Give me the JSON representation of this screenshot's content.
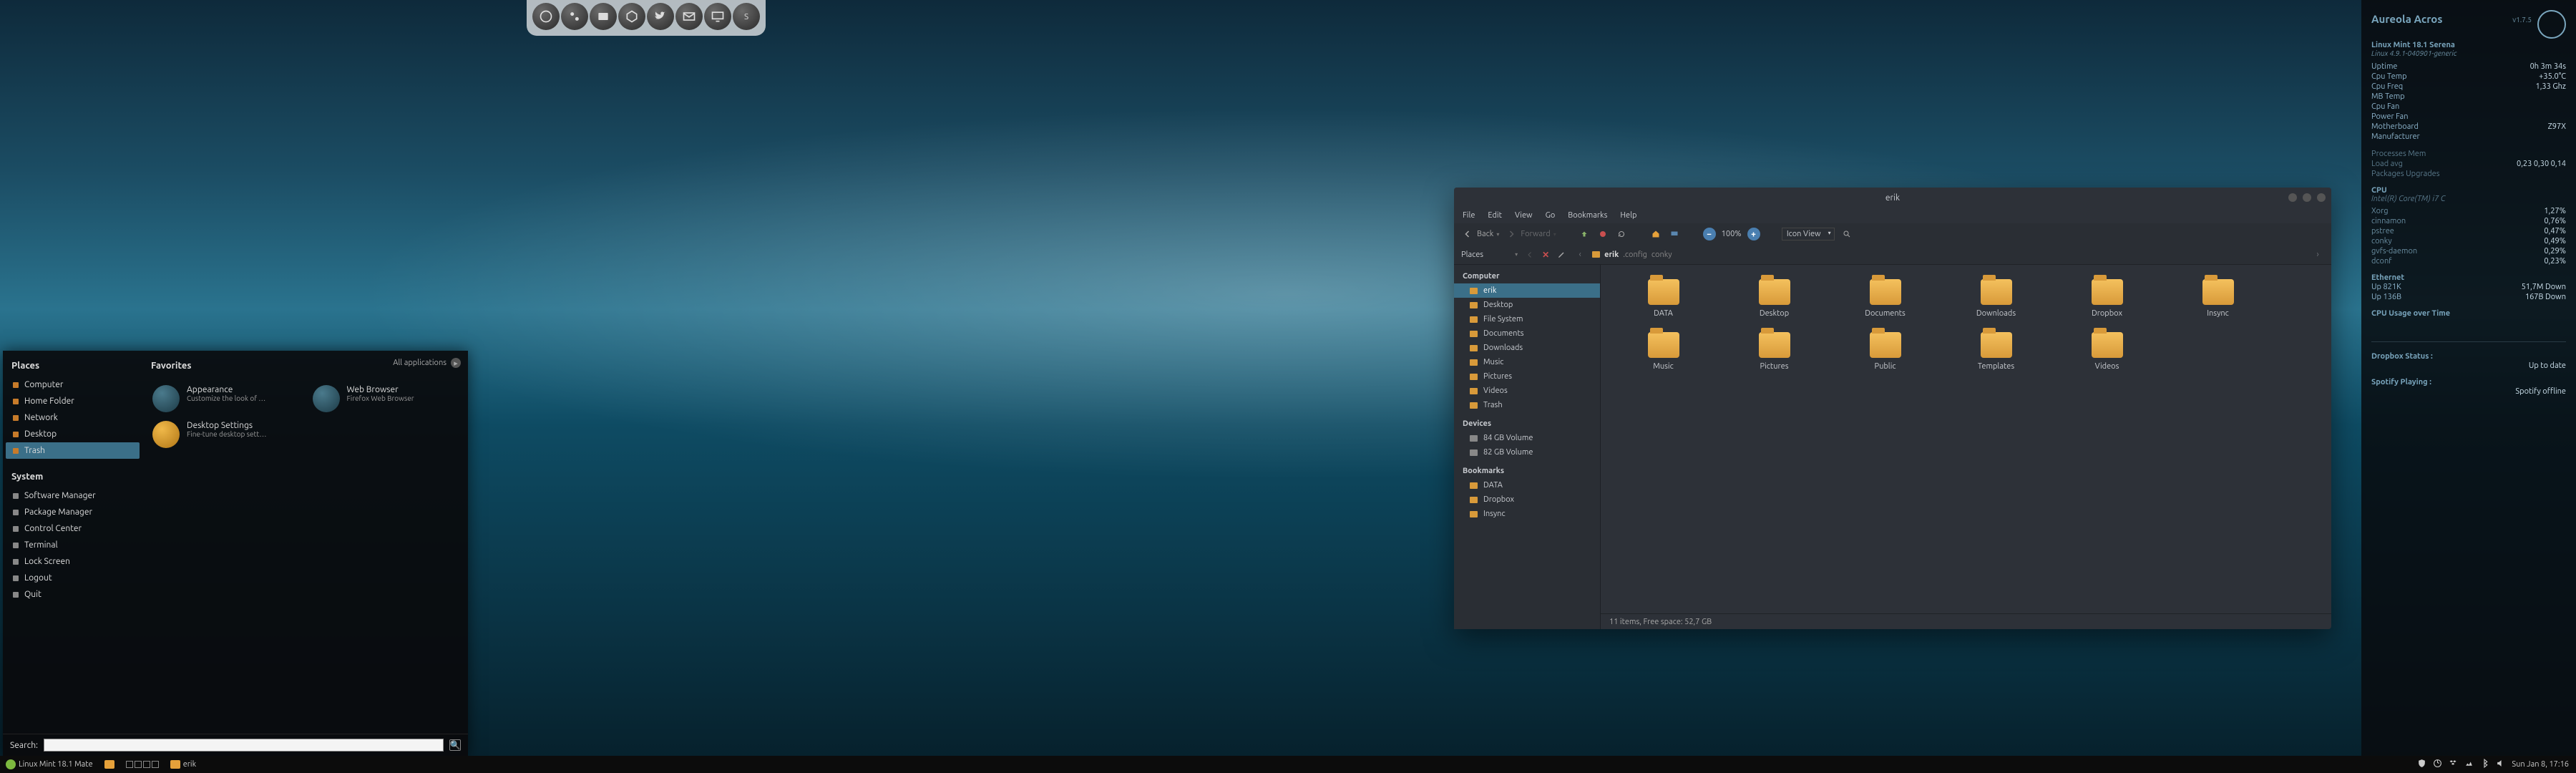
{
  "dock": {
    "items": [
      "firefox",
      "steam",
      "files",
      "software",
      "tweet",
      "mail",
      "display",
      "skype"
    ]
  },
  "menu": {
    "places_header": "Places",
    "places": [
      {
        "label": "Computer"
      },
      {
        "label": "Home Folder"
      },
      {
        "label": "Network"
      },
      {
        "label": "Desktop"
      },
      {
        "label": "Trash",
        "selected": true
      }
    ],
    "system_header": "System",
    "system": [
      {
        "label": "Software Manager"
      },
      {
        "label": "Package Manager"
      },
      {
        "label": "Control Center"
      },
      {
        "label": "Terminal"
      },
      {
        "label": "Lock Screen"
      },
      {
        "label": "Logout"
      },
      {
        "label": "Quit"
      }
    ],
    "favorites_header": "Favorites",
    "all_apps": "All applications",
    "favorites": [
      {
        "title": "Appearance",
        "sub": "Customize the look of …"
      },
      {
        "title": "Web Browser",
        "sub": "Firefox Web Browser"
      },
      {
        "title": "Desktop Settings",
        "sub": "Fine-tune desktop sett…",
        "yellow": true
      }
    ],
    "search_label": "Search:",
    "search_value": ""
  },
  "taskbar": {
    "distro": "Linux Mint 18.1 Mate",
    "task": "erik",
    "clock": "Sun Jan  8, 17:16"
  },
  "fm": {
    "title": "erik",
    "menus": [
      "File",
      "Edit",
      "View",
      "Go",
      "Bookmarks",
      "Help"
    ],
    "back": "Back",
    "forward": "Forward",
    "zoom": "100%",
    "viewmode": "Icon View",
    "loc_label": "Places",
    "crumbs": [
      "erik",
      ".config",
      "conky"
    ],
    "side": {
      "computer_header": "Computer",
      "computer": [
        {
          "label": "erik",
          "sel": true
        },
        {
          "label": "Desktop"
        },
        {
          "label": "File System"
        },
        {
          "label": "Documents"
        },
        {
          "label": "Downloads"
        },
        {
          "label": "Music"
        },
        {
          "label": "Pictures"
        },
        {
          "label": "Videos"
        },
        {
          "label": "Trash"
        }
      ],
      "devices_header": "Devices",
      "devices": [
        {
          "label": "84 GB Volume"
        },
        {
          "label": "82 GB Volume"
        }
      ],
      "bookmarks_header": "Bookmarks",
      "bookmarks": [
        {
          "label": "DATA"
        },
        {
          "label": "Dropbox"
        },
        {
          "label": "Insync"
        }
      ]
    },
    "grid": [
      "DATA",
      "Desktop",
      "Documents",
      "Downloads",
      "Dropbox",
      "Insync",
      "Music",
      "Pictures",
      "Public",
      "Templates",
      "Videos"
    ],
    "status": "11 items, Free space: 52,7 GB"
  },
  "conky": {
    "title": "Aureola Acros",
    "version": "v1.7.5",
    "distro": "Linux Mint 18.1 Serena",
    "kernel": "Linux 4.9.1-040901-generic",
    "rows1": [
      {
        "k": "Uptime",
        "v": "0h 3m 34s"
      },
      {
        "k": "Cpu Temp",
        "v": "+35.0°C"
      },
      {
        "k": "Cpu Freq",
        "v": "1,33 Ghz"
      },
      {
        "k": "MB Temp",
        "v": ""
      },
      {
        "k": "Cpu Fan",
        "v": ""
      },
      {
        "k": "Power Fan",
        "v": ""
      },
      {
        "k": "Motherboard",
        "v": "Z97X"
      },
      {
        "k": "Manufacturer",
        "v": ""
      }
    ],
    "mem_header": "Processes   Mem",
    "loadavg": "0,23 0,30 0,14",
    "pkg": "Packages Upgrades",
    "cpu_header": "CPU",
    "cpu_model": "Intel(R) Core(TM) i7 C",
    "procs": [
      {
        "k": "Xorg",
        "v": "1,27%"
      },
      {
        "k": "cinnamon",
        "v": "0,76%"
      },
      {
        "k": "pstree",
        "v": "0,47%"
      },
      {
        "k": "conky",
        "v": "0,49%"
      },
      {
        "k": "gvfs-daemon",
        "v": "0,29%"
      },
      {
        "k": "dconf",
        "v": "0,23%"
      }
    ],
    "eth_header": "Ethernet",
    "eth": [
      {
        "k": "Up 821K",
        "v": "51,7M Down"
      },
      {
        "k": "Up 136B",
        "v": "167B Down"
      }
    ],
    "cpu_over": "CPU Usage over Time",
    "dropbox_h": "Dropbox Status :",
    "dropbox_v": "Up to date",
    "spotify_h": "Spotify Playing :",
    "spotify_v": "Spotify offline"
  }
}
